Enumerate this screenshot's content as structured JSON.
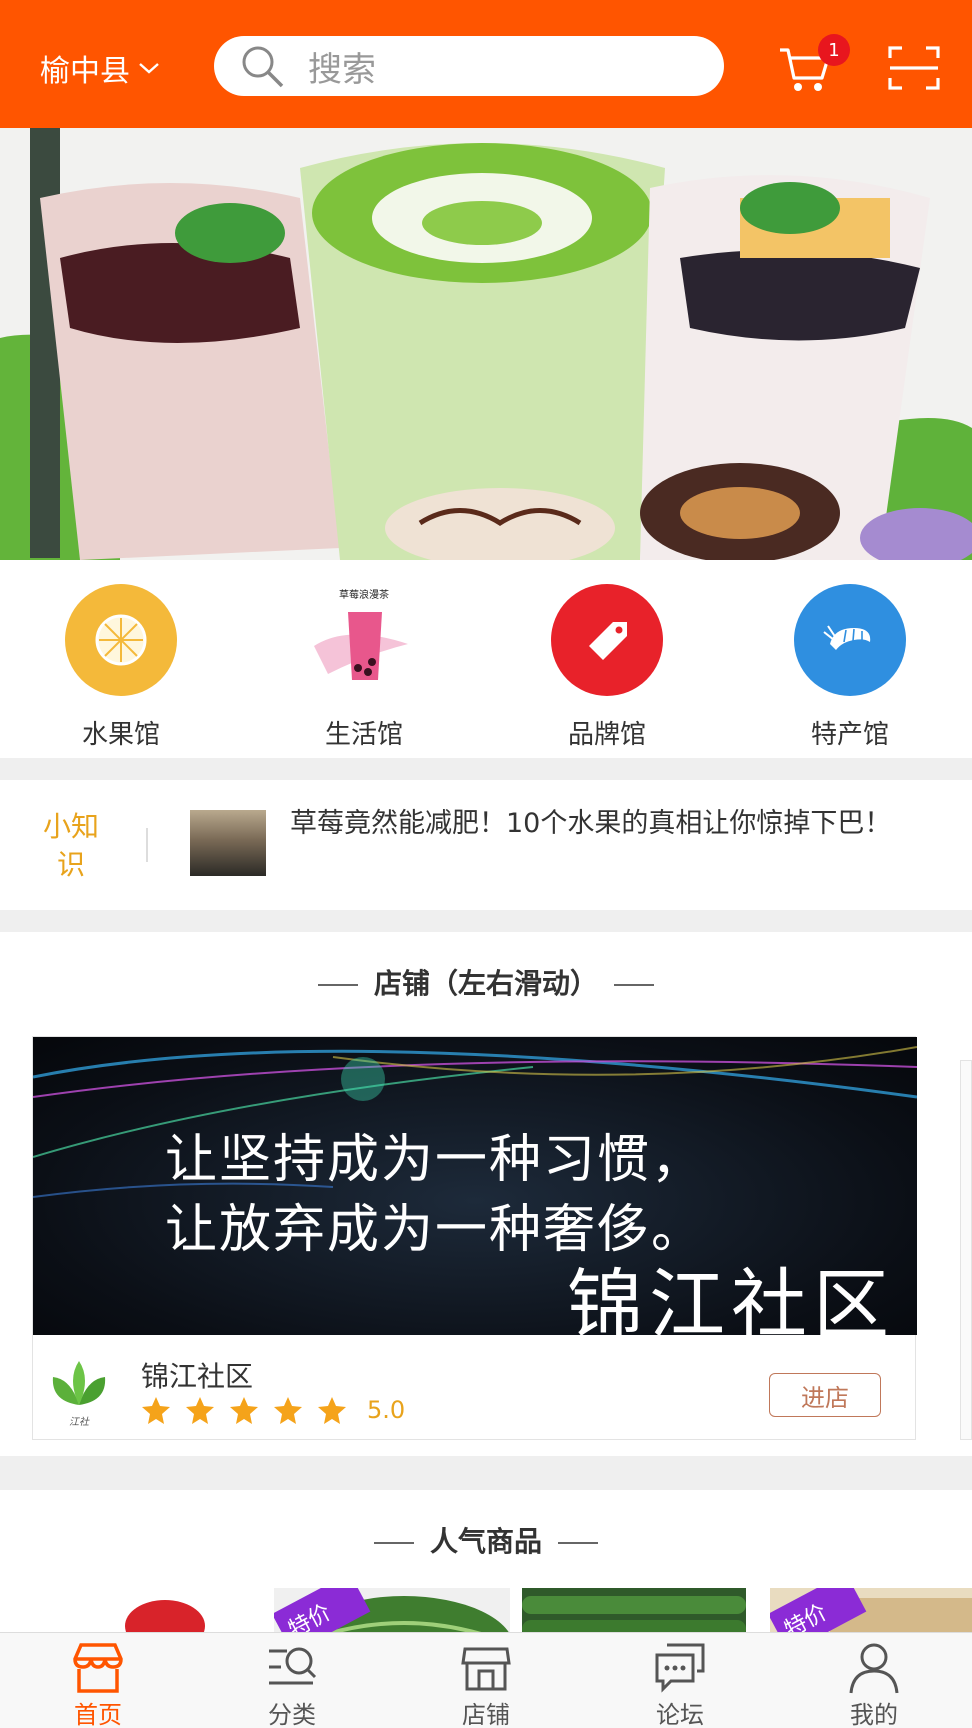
{
  "header": {
    "location": "榆中县",
    "search_placeholder": "搜索",
    "cart_badge": "1",
    "brand_color": "#ff5500"
  },
  "categories": [
    {
      "label": "水果馆",
      "icon": "lemon-icon"
    },
    {
      "label": "生活馆",
      "icon": "bubble-tea-icon",
      "icon_text": "草莓浪漫茶"
    },
    {
      "label": "品牌馆",
      "icon": "tag-icon"
    },
    {
      "label": "特产馆",
      "icon": "shrimp-icon"
    }
  ],
  "knowledge": {
    "tag": "小知识",
    "headline": "草莓竟然能减肥！10个水果的真相让你惊掉下巴！"
  },
  "stores_section": {
    "title": "店铺（左右滑动）",
    "store": {
      "banner_line1": "让坚持成为一种习惯，",
      "banner_line2": "让放弃成为一种奢侈。",
      "banner_name": "锦江社区",
      "logo_caption": "江社",
      "name": "锦江社区",
      "rating": "5.0",
      "stars": 5,
      "enter_label": "进店"
    }
  },
  "popular_section": {
    "title": "人气商品",
    "badges": [
      "特价",
      "特价"
    ]
  },
  "tabbar": [
    {
      "label": "首页",
      "icon": "home-store-icon",
      "active": true
    },
    {
      "label": "分类",
      "icon": "category-search-icon",
      "active": false
    },
    {
      "label": "店铺",
      "icon": "shop-icon",
      "active": false
    },
    {
      "label": "论坛",
      "icon": "forum-chat-icon",
      "active": false
    },
    {
      "label": "我的",
      "icon": "user-icon",
      "active": false
    }
  ]
}
